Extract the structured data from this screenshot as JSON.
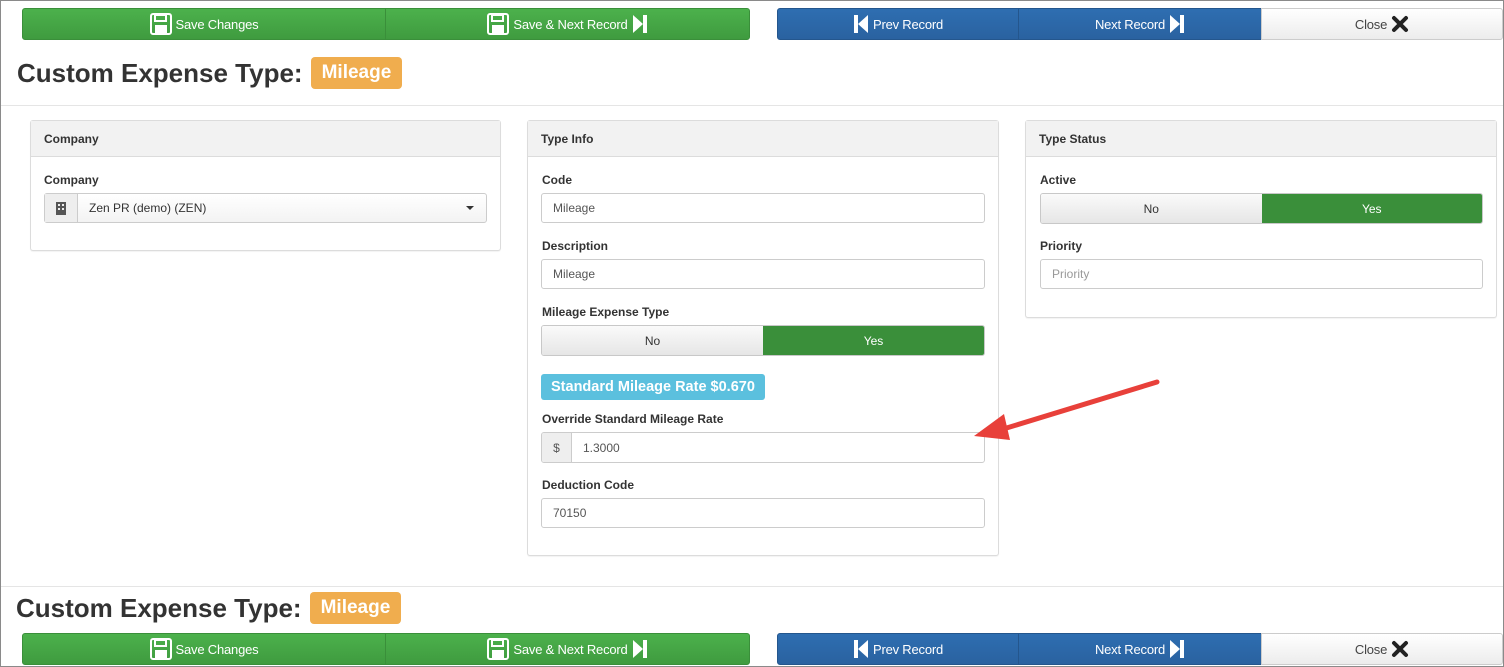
{
  "toolbar": {
    "save_label": "Save Changes",
    "save_next_label": "Save & Next Record",
    "prev_label": "Prev Record",
    "next_label": "Next Record",
    "close_label": "Close"
  },
  "header": {
    "title": "Custom Expense Type:",
    "badge": "Mileage"
  },
  "company_panel": {
    "heading": "Company",
    "company_label": "Company",
    "company_value": "Zen PR (demo) (ZEN)",
    "company_icon": "building-icon"
  },
  "type_info_panel": {
    "heading": "Type Info",
    "code_label": "Code",
    "code_value": "Mileage",
    "description_label": "Description",
    "description_value": "Mileage",
    "mileage_type_label": "Mileage Expense Type",
    "no_label": "No",
    "yes_label": "Yes",
    "mileage_type_value": "Yes",
    "standard_rate_badge": "Standard Mileage Rate $0.670",
    "override_label": "Override Standard Mileage Rate",
    "currency_symbol": "$",
    "override_value": "1.3000",
    "deduction_label": "Deduction Code",
    "deduction_value": "70150"
  },
  "type_status_panel": {
    "heading": "Type Status",
    "active_label": "Active",
    "no_label": "No",
    "yes_label": "Yes",
    "active_value": "Yes",
    "priority_label": "Priority",
    "priority_placeholder": "Priority"
  },
  "colors": {
    "green": "#3f9b3f",
    "blue": "#2a62a0",
    "orange_badge": "#f0ad4e",
    "info_badge": "#5bc0de",
    "annotation_arrow": "#e8403a"
  }
}
